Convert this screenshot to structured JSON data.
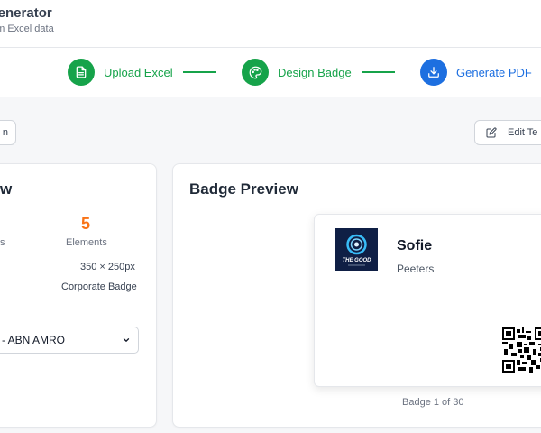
{
  "header": {
    "title": "Generator",
    "subtitle": "om Excel data"
  },
  "steps": [
    {
      "label": "Upload Excel",
      "icon": "file-text-icon",
      "state": "complete"
    },
    {
      "label": "Design Badge",
      "icon": "palette-icon",
      "state": "complete"
    },
    {
      "label": "Generate PDF",
      "icon": "download-icon",
      "state": "active"
    }
  ],
  "colors": {
    "complete": "#16a34a",
    "active": "#1d6fe0",
    "accent_orange": "#f97316"
  },
  "toolbar": {
    "left_button_label": "n",
    "edit_template_label": "Edit Te"
  },
  "overview_panel": {
    "title": "w",
    "elements_count": "5",
    "elements_label": "Elements",
    "left_stat_label": "s",
    "size": "350 × 250px",
    "template_type": "Corporate Badge",
    "template_select_value": "- ABN AMRO"
  },
  "preview_panel": {
    "title": "Badge Preview",
    "badge": {
      "first_name": "Sofie",
      "last_name": "Peeters",
      "logo_text": "THE GOOD"
    },
    "caption": "Badge 1 of 30"
  }
}
